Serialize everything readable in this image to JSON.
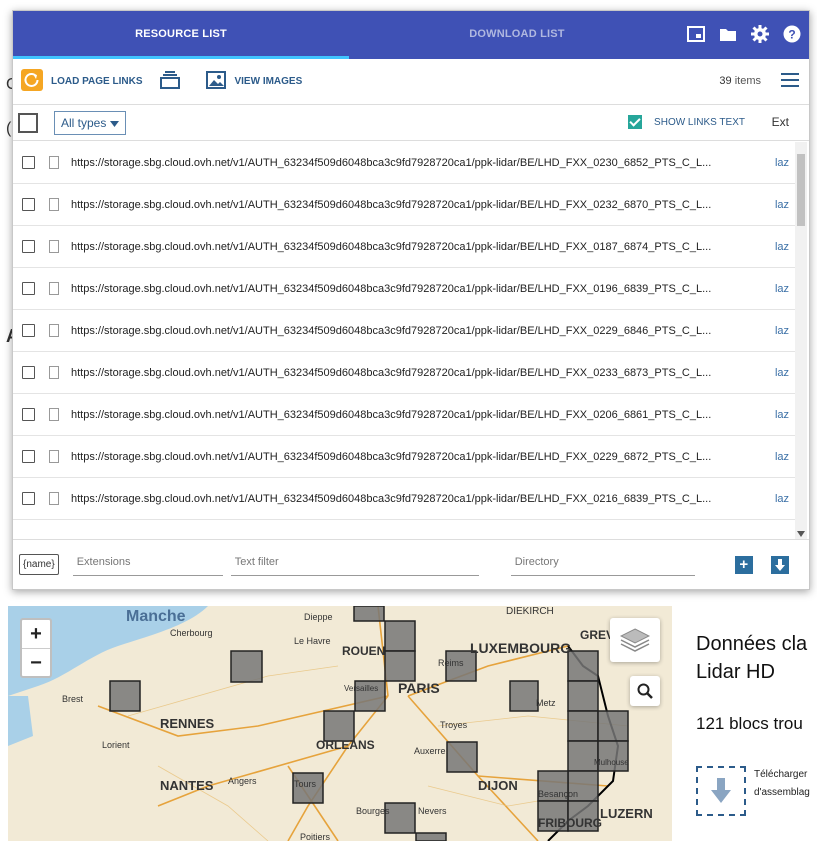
{
  "tabs": [
    {
      "label": "RESOURCE LIST"
    },
    {
      "label": "DOWNLOAD LIST"
    }
  ],
  "toolbar": {
    "load_label": "LOAD PAGE LINKS",
    "view_images_label": "VIEW IMAGES",
    "items_count": "39",
    "items_suffix": "items"
  },
  "filter": {
    "type_select": "All types",
    "show_links_text": "SHOW LINKS TEXT",
    "ext_header": "Ext"
  },
  "rows": [
    {
      "url": "https://storage.sbg.cloud.ovh.net/v1/AUTH_63234f509d6048bca3c9fd7928720ca1/ppk-lidar/BE/LHD_FXX_0230_6852_PTS_C_L...",
      "ext": "laz"
    },
    {
      "url": "https://storage.sbg.cloud.ovh.net/v1/AUTH_63234f509d6048bca3c9fd7928720ca1/ppk-lidar/BE/LHD_FXX_0232_6870_PTS_C_L...",
      "ext": "laz"
    },
    {
      "url": "https://storage.sbg.cloud.ovh.net/v1/AUTH_63234f509d6048bca3c9fd7928720ca1/ppk-lidar/BE/LHD_FXX_0187_6874_PTS_C_L...",
      "ext": "laz"
    },
    {
      "url": "https://storage.sbg.cloud.ovh.net/v1/AUTH_63234f509d6048bca3c9fd7928720ca1/ppk-lidar/BE/LHD_FXX_0196_6839_PTS_C_L...",
      "ext": "laz"
    },
    {
      "url": "https://storage.sbg.cloud.ovh.net/v1/AUTH_63234f509d6048bca3c9fd7928720ca1/ppk-lidar/BE/LHD_FXX_0229_6846_PTS_C_L...",
      "ext": "laz"
    },
    {
      "url": "https://storage.sbg.cloud.ovh.net/v1/AUTH_63234f509d6048bca3c9fd7928720ca1/ppk-lidar/BE/LHD_FXX_0233_6873_PTS_C_L...",
      "ext": "laz"
    },
    {
      "url": "https://storage.sbg.cloud.ovh.net/v1/AUTH_63234f509d6048bca3c9fd7928720ca1/ppk-lidar/BE/LHD_FXX_0206_6861_PTS_C_L...",
      "ext": "laz"
    },
    {
      "url": "https://storage.sbg.cloud.ovh.net/v1/AUTH_63234f509d6048bca3c9fd7928720ca1/ppk-lidar/BE/LHD_FXX_0229_6872_PTS_C_L...",
      "ext": "laz"
    },
    {
      "url": "https://storage.sbg.cloud.ovh.net/v1/AUTH_63234f509d6048bca3c9fd7928720ca1/ppk-lidar/BE/LHD_FXX_0216_6839_PTS_C_L...",
      "ext": "laz"
    }
  ],
  "bottom": {
    "name_button": "{name}",
    "extensions_placeholder": "Extensions",
    "text_filter_placeholder": "Text filter",
    "directory_placeholder": "Directory"
  },
  "map": {
    "labels": [
      "Manche",
      "Cherbourg",
      "Dieppe",
      "ROUEN",
      "Le Havre",
      "DIEKIRCH",
      "LUXEMBOURG",
      "GREVEN",
      "Reims",
      "PARIS",
      "Versailles",
      "Brest",
      "RENNES",
      "Lorient",
      "ORLEANS",
      "Troyes",
      "Auxerre",
      "NANTES",
      "Angers",
      "Tours",
      "DIJON",
      "Besançon",
      "FRIBOURG",
      "LUZERN",
      "Poitiers",
      "Bourges",
      "Nevers",
      "Mulhouse",
      "Metz"
    ]
  },
  "side": {
    "title_line1": "Données cla",
    "title_line2": "Lidar HD",
    "blocs": "121 blocs trou",
    "dl_line1": "Télécharger",
    "dl_line2": "d'assemblag"
  },
  "colors": {
    "tab_bar": "#3f51b5",
    "tab_underline": "#40c4ff",
    "accent_orange": "#f5a623",
    "link_blue": "#3a6fa6",
    "checkbox_teal": "#26a69a"
  }
}
